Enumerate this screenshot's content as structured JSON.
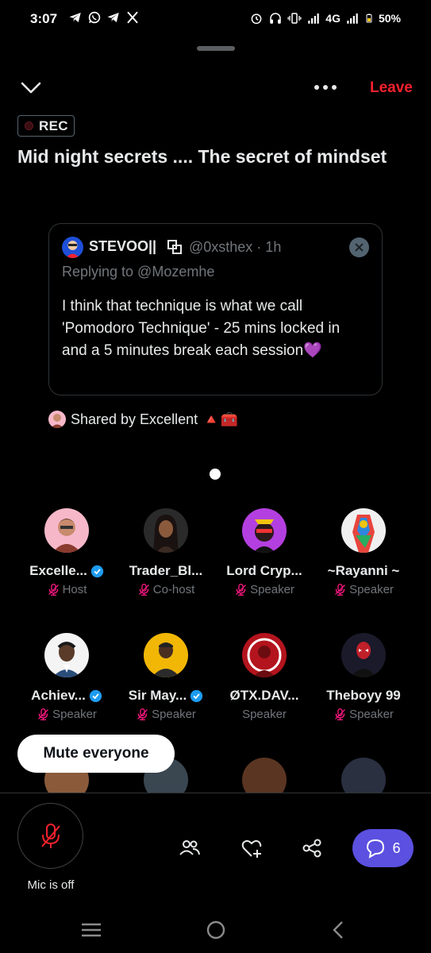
{
  "status_bar": {
    "time": "3:07",
    "network": "4G",
    "battery": "50%",
    "left_icons": [
      "telegram-icon",
      "whatsapp-icon",
      "telegram-icon",
      "x-icon"
    ],
    "right_icons": [
      "alarm-icon",
      "headphones-icon",
      "vibrate-icon",
      "signal-icon",
      "signal-icon",
      "battery-icon"
    ]
  },
  "header": {
    "leave_label": "Leave",
    "rec_label": "REC",
    "title": "Mid night secrets .... The secret of mindset"
  },
  "shared_tweet": {
    "author_name": "STEVOO||",
    "handle_time": "@0xsthex · 1h",
    "replying_to": "Replying to @Mozemhe",
    "body": "I think that technique is what we call 'Pomodoro Technique' - 25 mins locked in and a 5 minutes break each session💜"
  },
  "shared_by": {
    "label": "Shared by Excellent",
    "emojis": "🔺🧰"
  },
  "participants": [
    {
      "name": "Excelle...",
      "role": "Host",
      "verified": true,
      "mic_off": true
    },
    {
      "name": "Trader_Bl...",
      "role": "Co-host",
      "verified": false,
      "mic_off": true
    },
    {
      "name": "Lord Cryp...",
      "role": "Speaker",
      "verified": false,
      "mic_off": true
    },
    {
      "name": "~Rayanni ~",
      "role": "Speaker",
      "verified": false,
      "mic_off": true
    },
    {
      "name": "Achiev...",
      "role": "Speaker",
      "verified": true,
      "mic_off": true
    },
    {
      "name": "Sir May...",
      "role": "Speaker",
      "verified": true,
      "mic_off": true
    },
    {
      "name": "ØTX.DAV...",
      "role": "Speaker",
      "verified": false,
      "mic_off": false
    },
    {
      "name": "Theboyy 99",
      "role": "Speaker",
      "verified": false,
      "mic_off": true
    }
  ],
  "controls": {
    "mute_everyone": "Mute everyone",
    "mic_status": "Mic is off",
    "chat_count": "6"
  },
  "colors": {
    "leave": "#f4212e",
    "verified": "#1d9bf0",
    "mic_off": "#f91880",
    "chat_button": "#5b50e0"
  }
}
